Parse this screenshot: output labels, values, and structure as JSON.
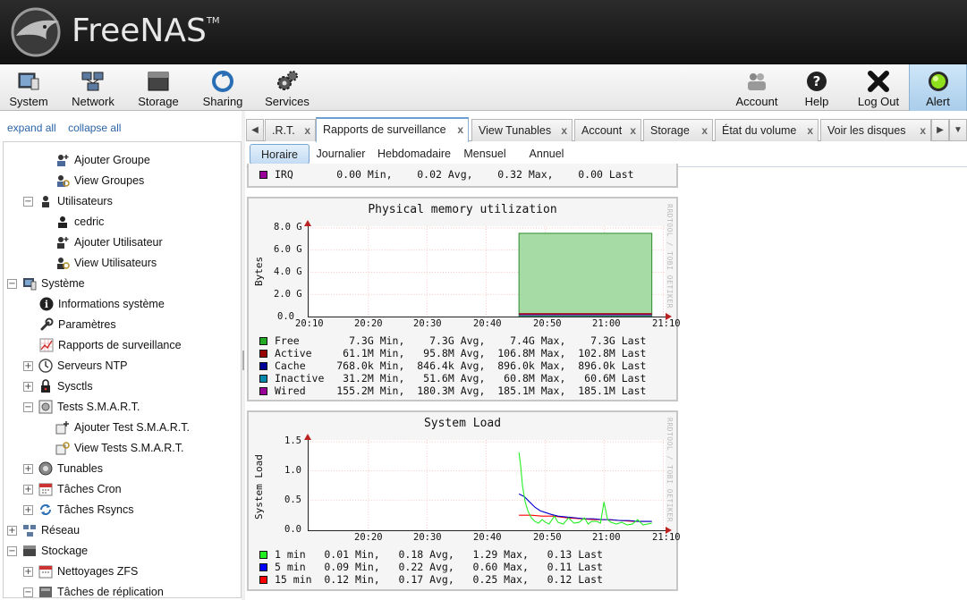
{
  "header": {
    "brand": "FreeNAS",
    "tm": "TM"
  },
  "toolbar": {
    "system": "System",
    "network": "Network",
    "storage": "Storage",
    "sharing": "Sharing",
    "services": "Services",
    "account": "Account",
    "help": "Help",
    "logout": "Log Out",
    "alert": "Alert"
  },
  "tree_links": {
    "expand": "expand all",
    "collapse": "collapse all"
  },
  "tree": [
    {
      "label": "Ajouter Groupe"
    },
    {
      "label": "View Groupes"
    },
    {
      "label": "Utilisateurs"
    },
    {
      "label": "cedric"
    },
    {
      "label": "Ajouter Utilisateur"
    },
    {
      "label": "View Utilisateurs"
    },
    {
      "label": "Système"
    },
    {
      "label": "Informations système"
    },
    {
      "label": "Paramètres"
    },
    {
      "label": "Rapports de surveillance"
    },
    {
      "label": "Serveurs NTP"
    },
    {
      "label": "Sysctls"
    },
    {
      "label": "Tests S.M.A.R.T."
    },
    {
      "label": "Ajouter Test S.M.A.R.T."
    },
    {
      "label": "View Tests S.M.A.R.T."
    },
    {
      "label": "Tunables"
    },
    {
      "label": "Tâches Cron"
    },
    {
      "label": "Tâches Rsyncs"
    },
    {
      "label": "Réseau"
    },
    {
      "label": "Stockage"
    },
    {
      "label": "Nettoyages ZFS"
    },
    {
      "label": "Tâches de réplication"
    }
  ],
  "tabs": [
    {
      "label": ".R.T."
    },
    {
      "label": "Rapports de surveillance"
    },
    {
      "label": "View Tunables"
    },
    {
      "label": "Account"
    },
    {
      "label": "Storage"
    },
    {
      "label": "État du volume"
    },
    {
      "label": "Voir les disques"
    }
  ],
  "tab_close": "x",
  "subtabs": [
    {
      "label": "Horaire"
    },
    {
      "label": "Journalier"
    },
    {
      "label": "Hebdomadaire"
    },
    {
      "label": "Mensuel"
    },
    {
      "label": "Annuel"
    }
  ],
  "irq_row": "IRQ       0.00 Min,    0.02 Avg,    0.32 Max,    0.00 Last",
  "watermark": "RRDTOOL / TOBI OETIKER",
  "x_ticks": [
    "20:10",
    "20:20",
    "20:30",
    "20:40",
    "20:50",
    "21:00",
    "21:10"
  ],
  "memory_chart": {
    "title": "Physical memory utilization",
    "ylabel": "Bytes",
    "y_ticks": [
      "8.0 G",
      "6.0 G",
      "4.0 G",
      "2.0 G",
      "0.0"
    ],
    "legend": [
      {
        "text": "Free        7.3G Min,    7.3G Avg,    7.4G Max,    7.3G Last",
        "color": "#22aa22"
      },
      {
        "text": "Active     61.1M Min,   95.8M Avg,  106.8M Max,  102.8M Last",
        "color": "#990000"
      },
      {
        "text": "Cache     768.0k Min,  846.4k Avg,  896.0k Max,  896.0k Last",
        "color": "#000099"
      },
      {
        "text": "Inactive   31.2M Min,   51.6M Avg,   60.8M Max,   60.6M Last",
        "color": "#0088aa"
      },
      {
        "text": "Wired     155.2M Min,  180.3M Avg,  185.1M Max,  185.1M Last",
        "color": "#990099"
      }
    ]
  },
  "load_chart": {
    "title": "System Load",
    "ylabel": "System Load",
    "y_ticks": [
      "1.5",
      "1.0",
      "0.5",
      "0.0"
    ],
    "legend": [
      {
        "text": "1 min   0.01 Min,   0.18 Avg,   1.29 Max,   0.13 Last",
        "color": "#22ee22"
      },
      {
        "text": "5 min   0.09 Min,   0.22 Avg,   0.60 Max,   0.11 Last",
        "color": "#0000ff"
      },
      {
        "text": "15 min  0.12 Min,   0.17 Avg,   0.25 Max,   0.12 Last",
        "color": "#ff0000"
      }
    ]
  },
  "colors": {
    "irq": "#990099"
  }
}
